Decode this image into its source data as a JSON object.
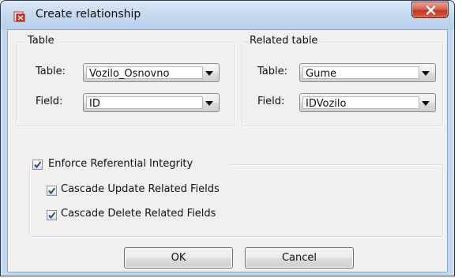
{
  "window": {
    "title": "Create relationship",
    "close_glyph": "x",
    "accent_color": "#c1392a"
  },
  "table_group": {
    "legend": "Table",
    "table_label": "Table:",
    "table_value": "Vozilo_Osnovno",
    "field_label": "Field:",
    "field_value": "ID"
  },
  "related_group": {
    "legend": "Related table",
    "table_label": "Table:",
    "table_value": "Gume",
    "field_label": "Field:",
    "field_value": "IDVozilo"
  },
  "integrity_group": {
    "enforce_label": "Enforce Referential Integrity",
    "enforce_checked": true,
    "cascade_update_label": "Cascade Update Related Fields",
    "cascade_update_checked": true,
    "cascade_delete_label": "Cascade Delete Related Fields",
    "cascade_delete_checked": true
  },
  "buttons": {
    "ok": "OK",
    "cancel": "Cancel"
  },
  "icons": {
    "app": "app-icon",
    "close": "close-icon",
    "dropdown": "chevron-down-icon",
    "check": "checkmark-icon"
  }
}
